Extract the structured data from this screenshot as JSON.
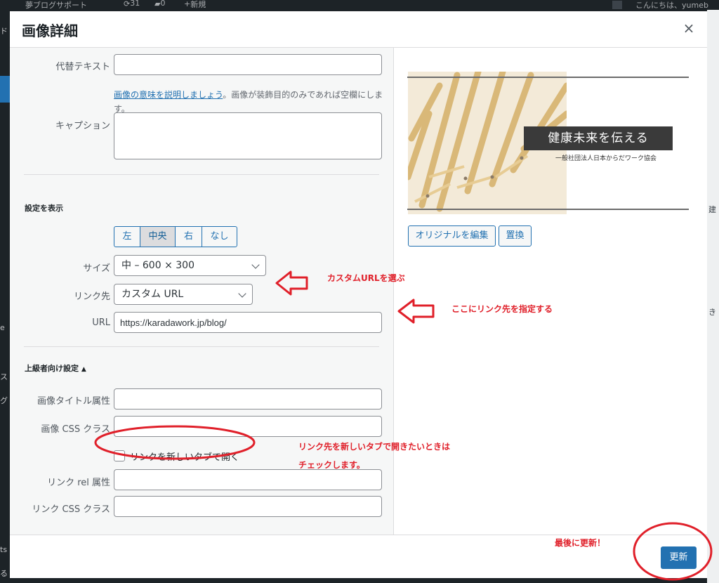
{
  "adminbar": {
    "site": "夢ブログサポート",
    "updates": "31",
    "comments": "0",
    "new_label": "新規",
    "greeting": "こんにちは、yumeb"
  },
  "background": {
    "left_fragments": [
      "ド",
      "e",
      "ス",
      "グ",
      "ts",
      "る"
    ],
    "right_fragments": [
      "建",
      "き"
    ]
  },
  "modal": {
    "title": "画像詳細",
    "close_icon": "×"
  },
  "settings": {
    "alt_label": "代替テキスト",
    "alt_value": "",
    "alt_help_link": "画像の意味を説明しましょう",
    "alt_help_text": "。画像が装飾目的のみであれば空欄にします。",
    "caption_label": "キャプション",
    "caption_value": "",
    "display_heading": "設定を表示",
    "align_options": [
      "左",
      "中央",
      "右",
      "なし"
    ],
    "align_selected": "中央",
    "size_label": "サイズ",
    "size_value": "中 – 600 × 300",
    "link_label": "リンク先",
    "link_value": "カスタム URL",
    "url_label": "URL",
    "url_value": "https://karadawork.jp/blog/",
    "advanced_heading": "上級者向け設定",
    "advanced_toggle_icon": "▲",
    "title_attr_label": "画像タイトル属性",
    "title_attr_value": "",
    "css_class_label": "画像 CSS クラス",
    "css_class_value": "",
    "new_tab_label": "リンクを新しいタブで開く",
    "new_tab_checked": false,
    "rel_label": "リンク rel 属性",
    "rel_value": "",
    "link_css_label": "リンク CSS クラス",
    "link_css_value": ""
  },
  "preview": {
    "banner_text": "健康未来を伝える",
    "sub_text": "一般社団法人日本からだワーク協会",
    "edit_original_label": "オリジナルを編集",
    "replace_label": "置換"
  },
  "footer": {
    "update_label": "更新"
  },
  "annotations": {
    "note_link": "カスタムURLを選ぶ",
    "note_url": "ここにリンク先を指定する",
    "note_newtab_1": "リンク先を新しいタブで開きたいときは",
    "note_newtab_2": "チェックします。",
    "note_update": "最後に更新！",
    "color": "#e0202a"
  },
  "colors": {
    "accent": "#2271b1",
    "admin_bg": "#1d2327",
    "pane_bg": "#f6f7f7"
  }
}
